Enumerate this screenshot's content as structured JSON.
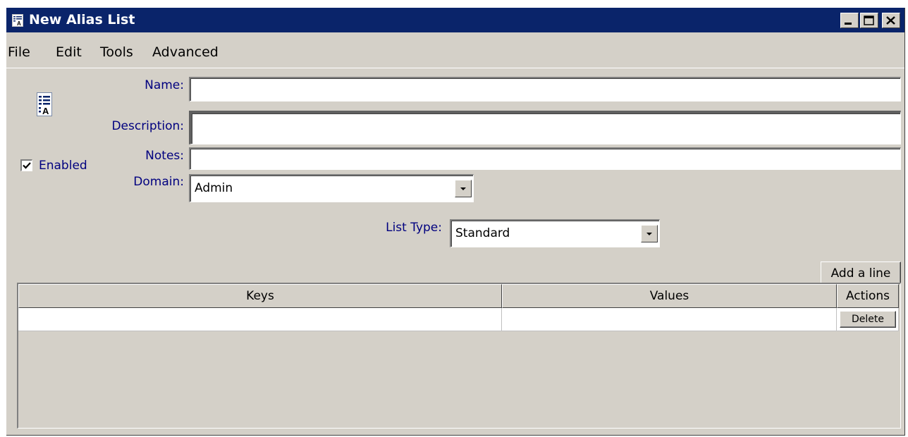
{
  "window": {
    "title": "New Alias List",
    "title_icon": "alias-list-icon"
  },
  "caption_buttons": {
    "minimize_icon": "minimize-icon",
    "maximize_icon": "maximize-icon",
    "close_icon": "close-icon"
  },
  "menu": {
    "items": [
      "File",
      "Edit",
      "Tools",
      "Advanced"
    ]
  },
  "form": {
    "list_icon": "alias-list-icon",
    "name": {
      "label": "Name:",
      "value": ""
    },
    "description": {
      "label": "Description:",
      "value": ""
    },
    "notes": {
      "label": "Notes:",
      "value": ""
    },
    "enabled": {
      "label": "Enabled",
      "checked": true
    },
    "domain": {
      "label": "Domain:",
      "value": "Admin"
    },
    "list_type": {
      "label": "List Type:",
      "value": "Standard"
    }
  },
  "toolbar": {
    "add_line_label": "Add a line"
  },
  "table": {
    "columns": [
      "Keys",
      "Values",
      "Actions"
    ],
    "rows": [
      {
        "key": "",
        "value": "",
        "action_label": "Delete"
      }
    ]
  },
  "colors": {
    "titlebar": "#0a246a",
    "window_face": "#d4d0c8",
    "label_text": "#00007f"
  }
}
